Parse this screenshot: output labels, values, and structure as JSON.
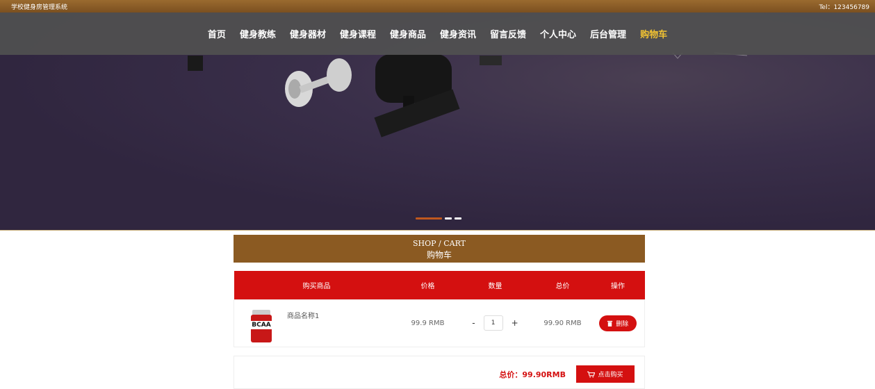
{
  "topbar": {
    "site_name": "学校健身房管理系统",
    "tel": "Tel：123456789"
  },
  "nav": {
    "items": [
      {
        "label": "首页"
      },
      {
        "label": "健身教练"
      },
      {
        "label": "健身器材"
      },
      {
        "label": "健身课程"
      },
      {
        "label": "健身商品"
      },
      {
        "label": "健身资讯"
      },
      {
        "label": "留言反馈"
      },
      {
        "label": "个人中心"
      },
      {
        "label": "后台管理"
      },
      {
        "label": "购物车"
      }
    ],
    "active_color": "#f1c232"
  },
  "section": {
    "title_en": "SHOP / CART",
    "title_cn": "购物车"
  },
  "cart": {
    "headers": [
      "购买商品",
      "价格",
      "数量",
      "总价",
      "操作"
    ],
    "items": [
      {
        "name": "商品名称1",
        "price": "99.9 RMB",
        "qty": "1",
        "total": "99.90 RMB",
        "image_label": "BCAA",
        "delete_label": "删除"
      }
    ],
    "minus": "-",
    "plus": "+",
    "total_label": "总价：99.90RMB",
    "buy_label": "点击购买"
  },
  "colors": {
    "accent_red": "#d41010",
    "brand_brown": "#8b5a22"
  }
}
